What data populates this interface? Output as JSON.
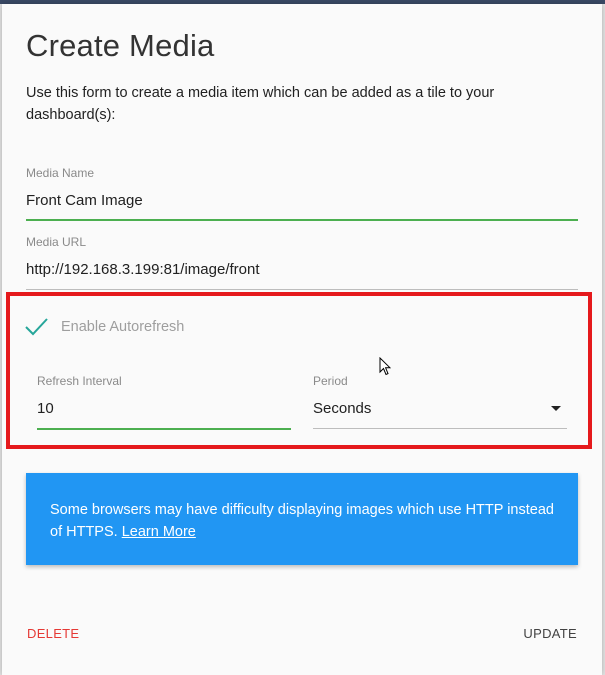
{
  "dialog": {
    "title": "Create Media",
    "description": "Use this form to create a media item which can be added as a tile to your dashboard(s):"
  },
  "form": {
    "media_name": {
      "label": "Media Name",
      "value": "Front Cam Image"
    },
    "media_url": {
      "label": "Media URL",
      "value": "http://192.168.3.199:81/image/front"
    },
    "autorefresh": {
      "label": "Enable Autorefresh",
      "checked": true
    },
    "refresh_interval": {
      "label": "Refresh Interval",
      "value": "10"
    },
    "period": {
      "label": "Period",
      "selected": "Seconds"
    }
  },
  "info": {
    "text": "Some browsers may have difficulty displaying images which use HTTP instead of HTTPS.",
    "link_label": "Learn More"
  },
  "actions": {
    "delete_label": "DELETE",
    "update_label": "UPDATE"
  },
  "colors": {
    "accent_green": "#4caf50",
    "check_teal": "#26a69a",
    "info_blue": "#2196f3",
    "delete_red": "#e53935",
    "highlight_red": "#e5191c"
  },
  "icons": {
    "autorefresh_check": "check-icon",
    "period_dropdown": "dropdown-arrow-icon",
    "pointer": "mouse-cursor-icon"
  }
}
